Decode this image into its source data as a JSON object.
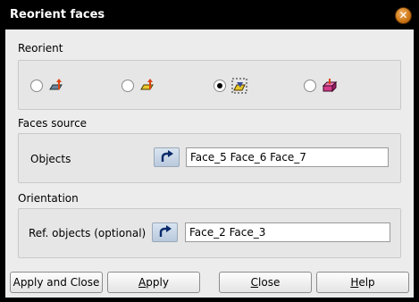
{
  "window": {
    "title": "Reorient faces"
  },
  "reorient": {
    "title": "Reorient",
    "options": [
      {
        "icon": "reorient-point-icon",
        "checked": false
      },
      {
        "icon": "reorient-vector-icon",
        "checked": false
      },
      {
        "icon": "reorient-object-icon",
        "checked": true
      },
      {
        "icon": "reorient-volume-icon",
        "checked": false
      }
    ]
  },
  "faces_source": {
    "title": "Faces source",
    "objects_label": "Objects",
    "objects_value": "Face_5 Face_6 Face_7"
  },
  "orientation": {
    "title": "Orientation",
    "ref_label": "Ref. objects (optional)",
    "ref_value": "Face_2 Face_3"
  },
  "buttons": {
    "apply_close": "Apply and Close",
    "apply": "Apply",
    "close": "Close",
    "help": "Help"
  }
}
